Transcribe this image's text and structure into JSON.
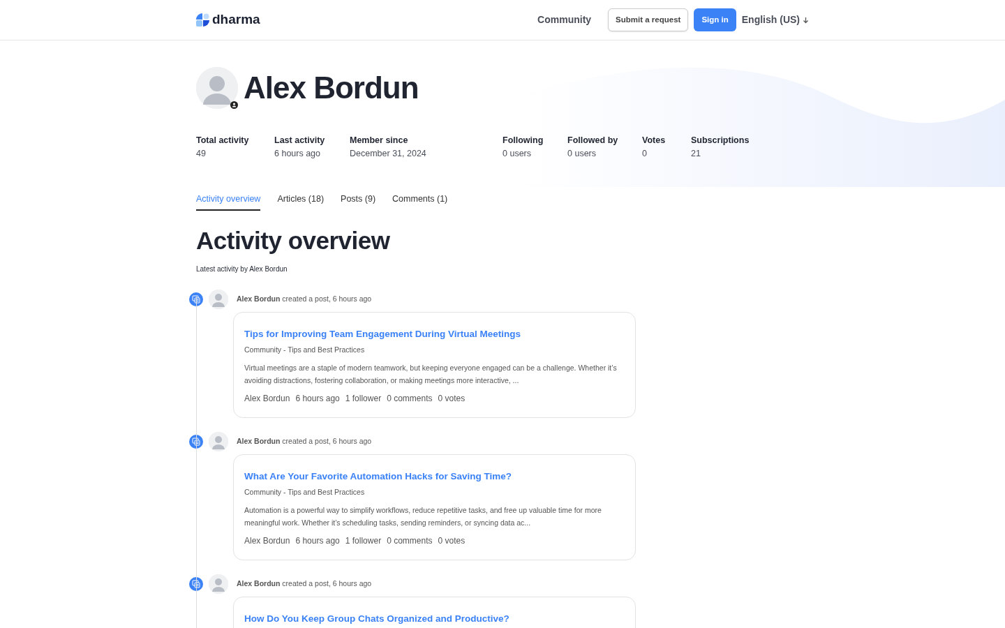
{
  "header": {
    "logo": "dharma",
    "nav": [
      {
        "label": "Community",
        "kind": "link"
      },
      {
        "label": "Submit a request",
        "kind": "outline"
      },
      {
        "label": "Sign in",
        "kind": "primary"
      },
      {
        "label": "English (US)",
        "kind": "dropdown"
      }
    ]
  },
  "profile": {
    "name": "Alex Bordun",
    "stats": [
      {
        "label": "Total activity",
        "value": "49"
      },
      {
        "label": "Last activity",
        "value": "6 hours ago"
      },
      {
        "label": "Member since",
        "value": "December 31, 2024"
      },
      {
        "label": "Following",
        "value": "0 users"
      },
      {
        "label": "Followed by",
        "value": "0 users"
      },
      {
        "label": "Votes",
        "value": "0"
      },
      {
        "label": "Subscriptions",
        "value": "21"
      }
    ]
  },
  "tabs": [
    {
      "label": "Activity overview",
      "selected": true
    },
    {
      "label": "Articles (18)",
      "selected": false
    },
    {
      "label": "Posts (9)",
      "selected": false
    },
    {
      "label": "Comments (1)",
      "selected": false
    }
  ],
  "section": {
    "title": "Activity overview",
    "subtitle": "Latest activity by Alex Bordun"
  },
  "feed": [
    {
      "actor": "Alex Bordun",
      "action": "created a post, 6 hours ago",
      "title": "Tips for Improving Team Engagement During Virtual Meetings",
      "category": "Community - Tips and Best Practices",
      "excerpt": "Virtual meetings are a staple of modern teamwork, but keeping everyone engaged can be a challenge. Whether it’s avoiding distractions, fostering collaboration, or making meetings more interactive, ...",
      "meta": [
        "Alex Bordun",
        "6 hours ago",
        "1 follower",
        "0 comments",
        "0 votes"
      ]
    },
    {
      "actor": "Alex Bordun",
      "action": "created a post, 6 hours ago",
      "title": "What Are Your Favorite Automation Hacks for Saving Time?",
      "category": "Community - Tips and Best Practices",
      "excerpt": "Automation is a powerful way to simplify workflows, reduce repetitive tasks, and free up valuable time for more meaningful work. Whether it’s scheduling tasks, sending reminders, or syncing data ac...",
      "meta": [
        "Alex Bordun",
        "6 hours ago",
        "1 follower",
        "0 comments",
        "0 votes"
      ]
    },
    {
      "actor": "Alex Bordun",
      "action": "created a post, 6 hours ago",
      "title": "How Do You Keep Group Chats Organized and Productive?"
    }
  ]
}
